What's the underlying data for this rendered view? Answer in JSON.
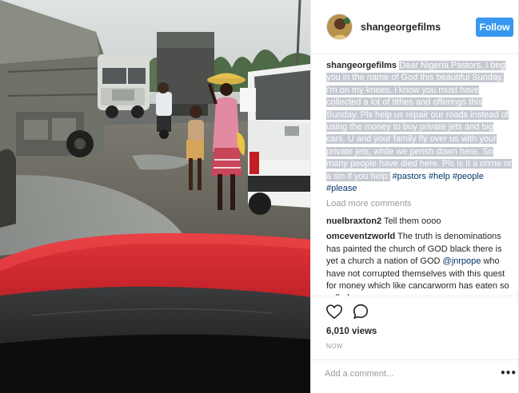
{
  "post": {
    "username": "shangeorgefilms",
    "follow_label": "Follow",
    "caption_user": "shangeorgefilms",
    "caption_text": "Dear Nigeria Pastors, I beg you in the name of God this beautiful Sunday, i'm on my knees, i know you must have collected a lot of tithes and offerings this Sunday. Pls help us repair our roads instead of using the money to buy private jets and big cars. U and your family fly over us with your private jets, while we perish down here. So many people have died here. Pls is it a crime or a sin if you help:",
    "hashtags": [
      "#pastors",
      "#help",
      "#people",
      "#please"
    ],
    "load_more_label": "Load more comments",
    "comments": [
      {
        "user": "nuelbraxton2",
        "text": "Tell them oooo"
      },
      {
        "user": "omceventzworld",
        "text_before": "The truth is denominations has painted the church of GOD black there is yet a church a nation of GOD",
        "mention": "@jnrpope",
        "text_after": "who have not corrupted themselves with this quest for money which like cancarworm has eaten so called"
      }
    ],
    "views": "6,010 views",
    "timestamp": "NOW",
    "comment_placeholder": "Add a comment...",
    "more_options": "•••"
  },
  "icons": {
    "like": "heart-icon",
    "comment": "speech-bubble-icon",
    "more": "ellipsis-icon"
  },
  "colors": {
    "accent": "#3897f0",
    "hashtag": "#003569",
    "caption_highlight": "#c5c9d1",
    "car_hood": "#d3252b"
  }
}
